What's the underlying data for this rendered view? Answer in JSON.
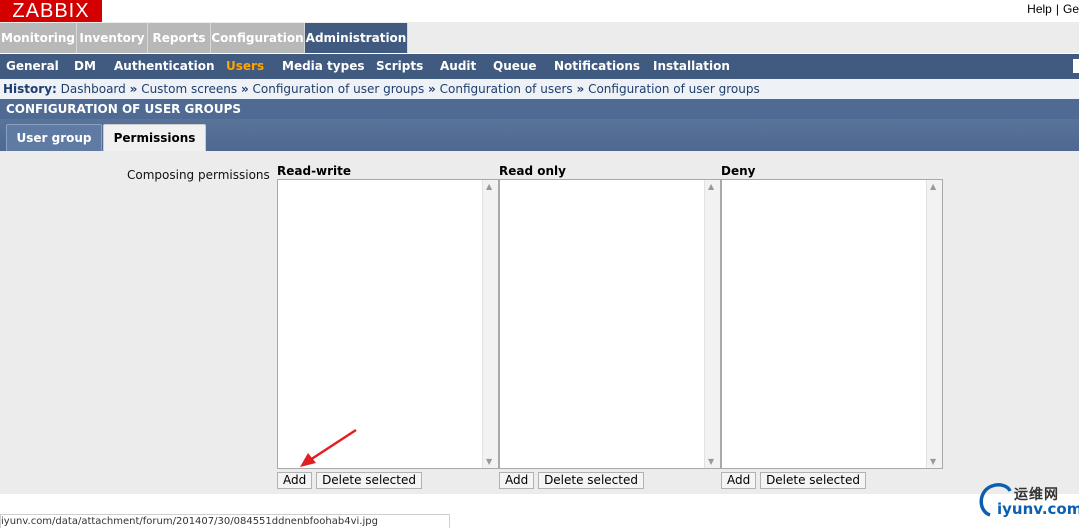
{
  "header": {
    "logo": "ZABBIX",
    "help": "Help",
    "separator": "|",
    "get_support": "Ge"
  },
  "main_menu": [
    "Monitoring",
    "Inventory",
    "Reports",
    "Configuration",
    "Administration"
  ],
  "sub_menu": [
    "General",
    "DM",
    "Authentication",
    "Users",
    "Media types",
    "Scripts",
    "Audit",
    "Queue",
    "Notifications",
    "Installation"
  ],
  "history": {
    "label": "History:",
    "items": [
      "Dashboard",
      "Custom screens",
      "Configuration of user groups",
      "Configuration of users",
      "Configuration of user groups"
    ],
    "separator": "»"
  },
  "page_title": "CONFIGURATION OF USER GROUPS",
  "tabs": [
    "User group",
    "Permissions"
  ],
  "form": {
    "composing_label": "Composing permissions",
    "columns": [
      {
        "title": "Read-write",
        "add": "Add",
        "delete": "Delete selected"
      },
      {
        "title": "Read only",
        "add": "Add",
        "delete": "Delete selected"
      },
      {
        "title": "Deny",
        "add": "Add",
        "delete": "Delete selected"
      }
    ]
  },
  "status_bar": "iyunv.com/data/attachment/forum/201407/30/084551ddnenbfoohab4vi.jpg",
  "watermark": {
    "top": "运维网",
    "bottom": "iyunv.com"
  },
  "colors": {
    "logo": "#d40000",
    "menu_active": "#415a7f",
    "submenu_active": "#ffa500",
    "arrow": "#e02020"
  }
}
